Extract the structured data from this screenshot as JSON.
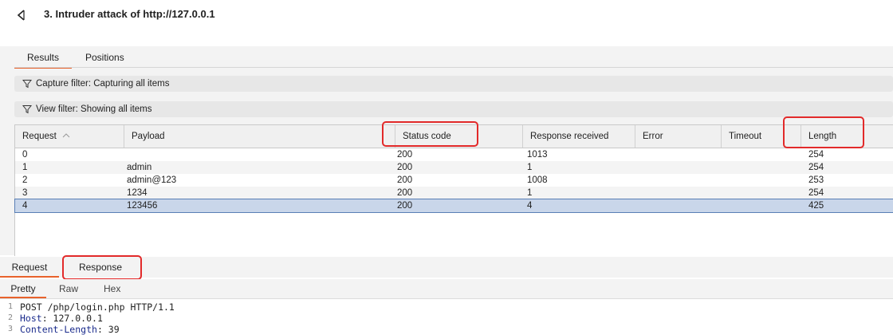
{
  "window": {
    "title": "3. Intruder attack of http://127.0.0.1"
  },
  "tabs": {
    "results": "Results",
    "positions": "Positions"
  },
  "filters": {
    "capture": "Capture filter: Capturing all items",
    "view": "View filter: Showing all items"
  },
  "table": {
    "headers": {
      "request": "Request",
      "payload": "Payload",
      "status": "Status code",
      "received": "Response received",
      "error": "Error",
      "timeout": "Timeout",
      "length": "Length"
    },
    "rows": [
      {
        "request": "0",
        "payload": "",
        "status": "200",
        "received": "1013",
        "error": "",
        "timeout": "",
        "length": "254"
      },
      {
        "request": "1",
        "payload": "admin",
        "status": "200",
        "received": "1",
        "error": "",
        "timeout": "",
        "length": "254"
      },
      {
        "request": "2",
        "payload": "admin@123",
        "status": "200",
        "received": "1008",
        "error": "",
        "timeout": "",
        "length": "253"
      },
      {
        "request": "3",
        "payload": "1234",
        "status": "200",
        "received": "1",
        "error": "",
        "timeout": "",
        "length": "254"
      },
      {
        "request": "4",
        "payload": "123456",
        "status": "200",
        "received": "4",
        "error": "",
        "timeout": "",
        "length": "425"
      }
    ],
    "selected_row": 4
  },
  "message_tabs": {
    "request": "Request",
    "response": "Response"
  },
  "view_tabs": {
    "pretty": "Pretty",
    "raw": "Raw",
    "hex": "Hex"
  },
  "code": {
    "lines": [
      {
        "num": "1",
        "text": "POST /php/login.php HTTP/1.1"
      },
      {
        "num": "2",
        "name": "Host",
        "value": ": 127.0.0.1"
      },
      {
        "num": "3",
        "name": "Content-Length",
        "value": ": 39"
      }
    ]
  },
  "colors": {
    "accent": "#e8622c",
    "highlight": "#e22a2a",
    "selected_row": "#c9d6ea"
  }
}
